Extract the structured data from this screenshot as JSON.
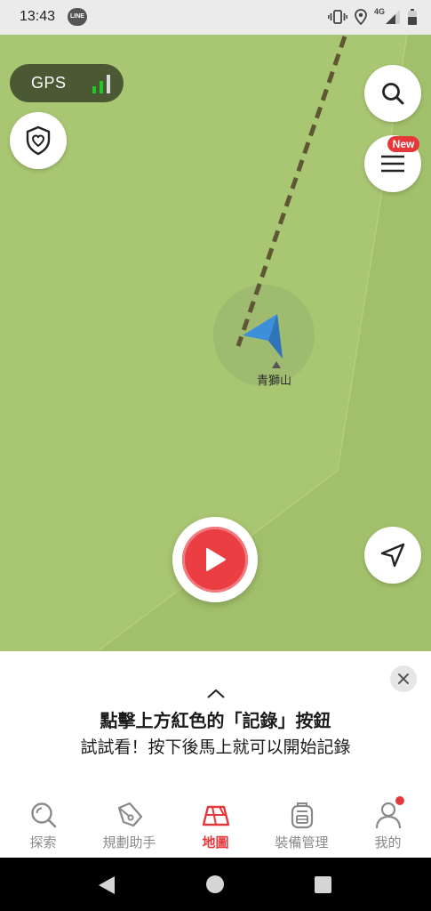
{
  "status_bar": {
    "time": "13:43",
    "line_badge": "LINE",
    "network": "4G",
    "icons": [
      "line-app-icon",
      "vibrate-icon",
      "location-icon",
      "signal-icon",
      "battery-icon"
    ]
  },
  "map": {
    "gps_label": "GPS",
    "gps_signal_bars_active": 2,
    "gps_signal_bars_total": 3,
    "new_badge": "New",
    "peak_name": "青獅山",
    "colors": {
      "land": "#a9c673",
      "land_dark": "#a2c06b",
      "trail": "#5e5634",
      "arrow": "#3d8fd9"
    }
  },
  "sheet": {
    "title": "點擊上方紅色的「記錄」按鈕",
    "subtitle": "試試看！按下後馬上就可以開始記錄"
  },
  "bottom_nav": {
    "items": [
      {
        "label": "探索",
        "icon": "explore-search-icon",
        "active": false
      },
      {
        "label": "規劃助手",
        "icon": "pen-plan-icon",
        "active": false
      },
      {
        "label": "地圖",
        "icon": "map-icon",
        "active": true
      },
      {
        "label": "裝備管理",
        "icon": "backpack-icon",
        "active": false
      },
      {
        "label": "我的",
        "icon": "user-icon",
        "active": false
      }
    ]
  },
  "theme": {
    "accent": "#e5383b",
    "inactive": "#8a8a8a"
  }
}
